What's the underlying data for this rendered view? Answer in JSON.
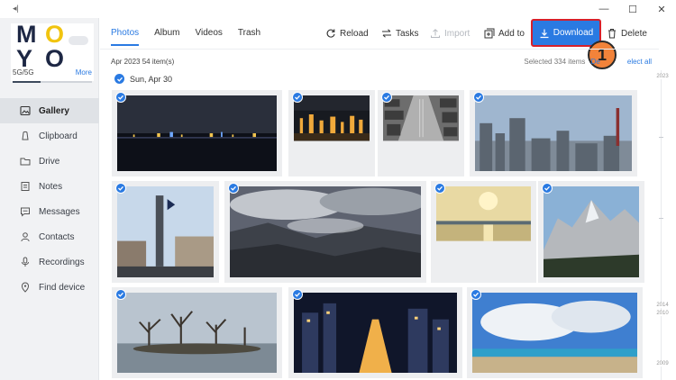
{
  "window": {
    "controls": [
      "minimize",
      "maximize",
      "close"
    ]
  },
  "sidebar": {
    "logo": {
      "letters": [
        "M",
        "O",
        "Y",
        "O"
      ]
    },
    "device": {
      "name": "5G/5G",
      "more_label": "More",
      "storage_fraction": 0.35
    },
    "items": [
      {
        "label": "Gallery",
        "icon": "gallery-icon",
        "active": true
      },
      {
        "label": "Clipboard",
        "icon": "clipboard-icon",
        "active": false
      },
      {
        "label": "Drive",
        "icon": "folder-icon",
        "active": false
      },
      {
        "label": "Notes",
        "icon": "note-icon",
        "active": false
      },
      {
        "label": "Messages",
        "icon": "message-icon",
        "active": false
      },
      {
        "label": "Contacts",
        "icon": "contact-icon",
        "active": false
      },
      {
        "label": "Recordings",
        "icon": "microphone-icon",
        "active": false
      },
      {
        "label": "Find device",
        "icon": "location-pin-icon",
        "active": false
      }
    ]
  },
  "tabs": [
    {
      "label": "Photos",
      "active": true
    },
    {
      "label": "Album",
      "active": false
    },
    {
      "label": "Videos",
      "active": false
    },
    {
      "label": "Trash",
      "active": false
    }
  ],
  "toolbar": {
    "reload": "Reload",
    "tasks": "Tasks",
    "import": "Import",
    "add_to": "Add to",
    "download": "Download",
    "delete": "Delete"
  },
  "callout": "1",
  "meta": {
    "date_label": "Apr 2023 54 item(s)",
    "selected_label": "Selected 334 items",
    "deselect_fragment": "De",
    "select_all_fragment": "elect all"
  },
  "day": {
    "label": "Sun, Apr 30"
  },
  "photos": [
    {
      "subject": "night-harbor",
      "selected": true
    },
    {
      "subject": "night-city-lights",
      "selected": true
    },
    {
      "subject": "aerial-street-bw",
      "selected": true
    },
    {
      "subject": "city-skyline",
      "selected": true
    },
    {
      "subject": "town-monument",
      "selected": true
    },
    {
      "subject": "mountains-clouds",
      "selected": true
    },
    {
      "subject": "sunset-lake",
      "selected": true
    },
    {
      "subject": "rocky-mountain",
      "selected": true
    },
    {
      "subject": "winter-trees",
      "selected": true
    },
    {
      "subject": "night-street",
      "selected": true
    },
    {
      "subject": "beach-clouds",
      "selected": true
    }
  ],
  "timeline": {
    "labels": [
      "2023",
      "2014",
      "2010",
      "2009"
    ]
  },
  "colors": {
    "accent": "#2a7ae2",
    "callout": "#f2833a",
    "highlight_border": "#d6202b",
    "sidebar_bg": "#f1f2f4"
  }
}
